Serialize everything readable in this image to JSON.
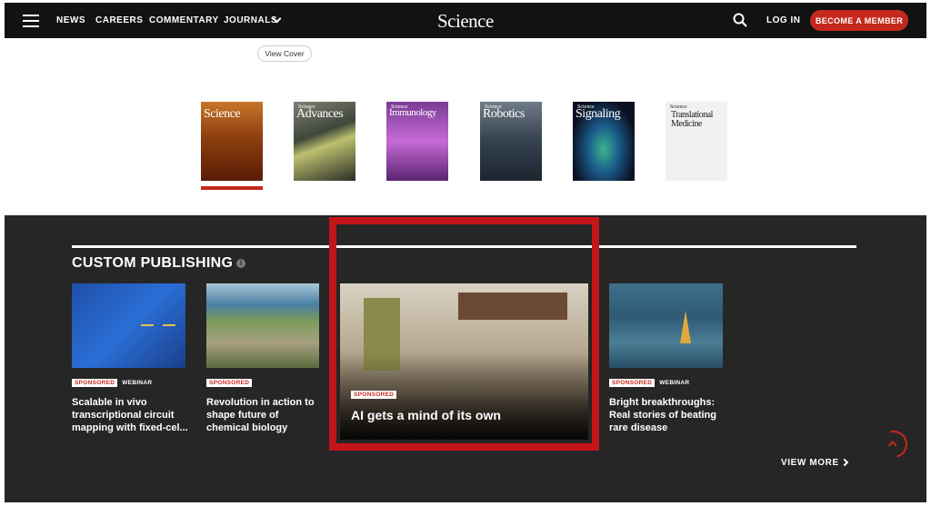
{
  "header": {
    "nav": [
      "NEWS",
      "CAREERS",
      "COMMENTARY",
      "JOURNALS"
    ],
    "logo": "Science",
    "login": "LOG IN",
    "member": "BECOME A MEMBER"
  },
  "view_cover": "View Cover",
  "covers": [
    {
      "title": "Science",
      "small": ""
    },
    {
      "title": "Advances",
      "small": "Science"
    },
    {
      "title": "Immunology",
      "small": "Science"
    },
    {
      "title": "Robotics",
      "small": "Science"
    },
    {
      "title": "Signaling",
      "small": "Science"
    },
    {
      "title": "Translational Medicine",
      "small": "Science"
    }
  ],
  "custom": {
    "title": "CUSTOM PUBLISHING",
    "cards": [
      {
        "badge": "SPONSORED",
        "tag": "WEBINAR",
        "title": "Scalable in vivo transcriptional circuit mapping with fixed-cel..."
      },
      {
        "badge": "SPONSORED",
        "tag": "",
        "title": "Revolution in action to shape future of chemical biology"
      },
      {
        "badge": "SPONSORED",
        "tag": "",
        "title": "AI gets a mind of its own"
      },
      {
        "badge": "SPONSORED",
        "tag": "WEBINAR",
        "title": "Bright breakthroughs: Real stories of beating rare disease"
      }
    ],
    "view_more": "VIEW MORE"
  },
  "colors": {
    "accent": "#c5291d",
    "highlight": "#c4151a",
    "nav_bg": "#121212",
    "section_bg": "#262626"
  }
}
